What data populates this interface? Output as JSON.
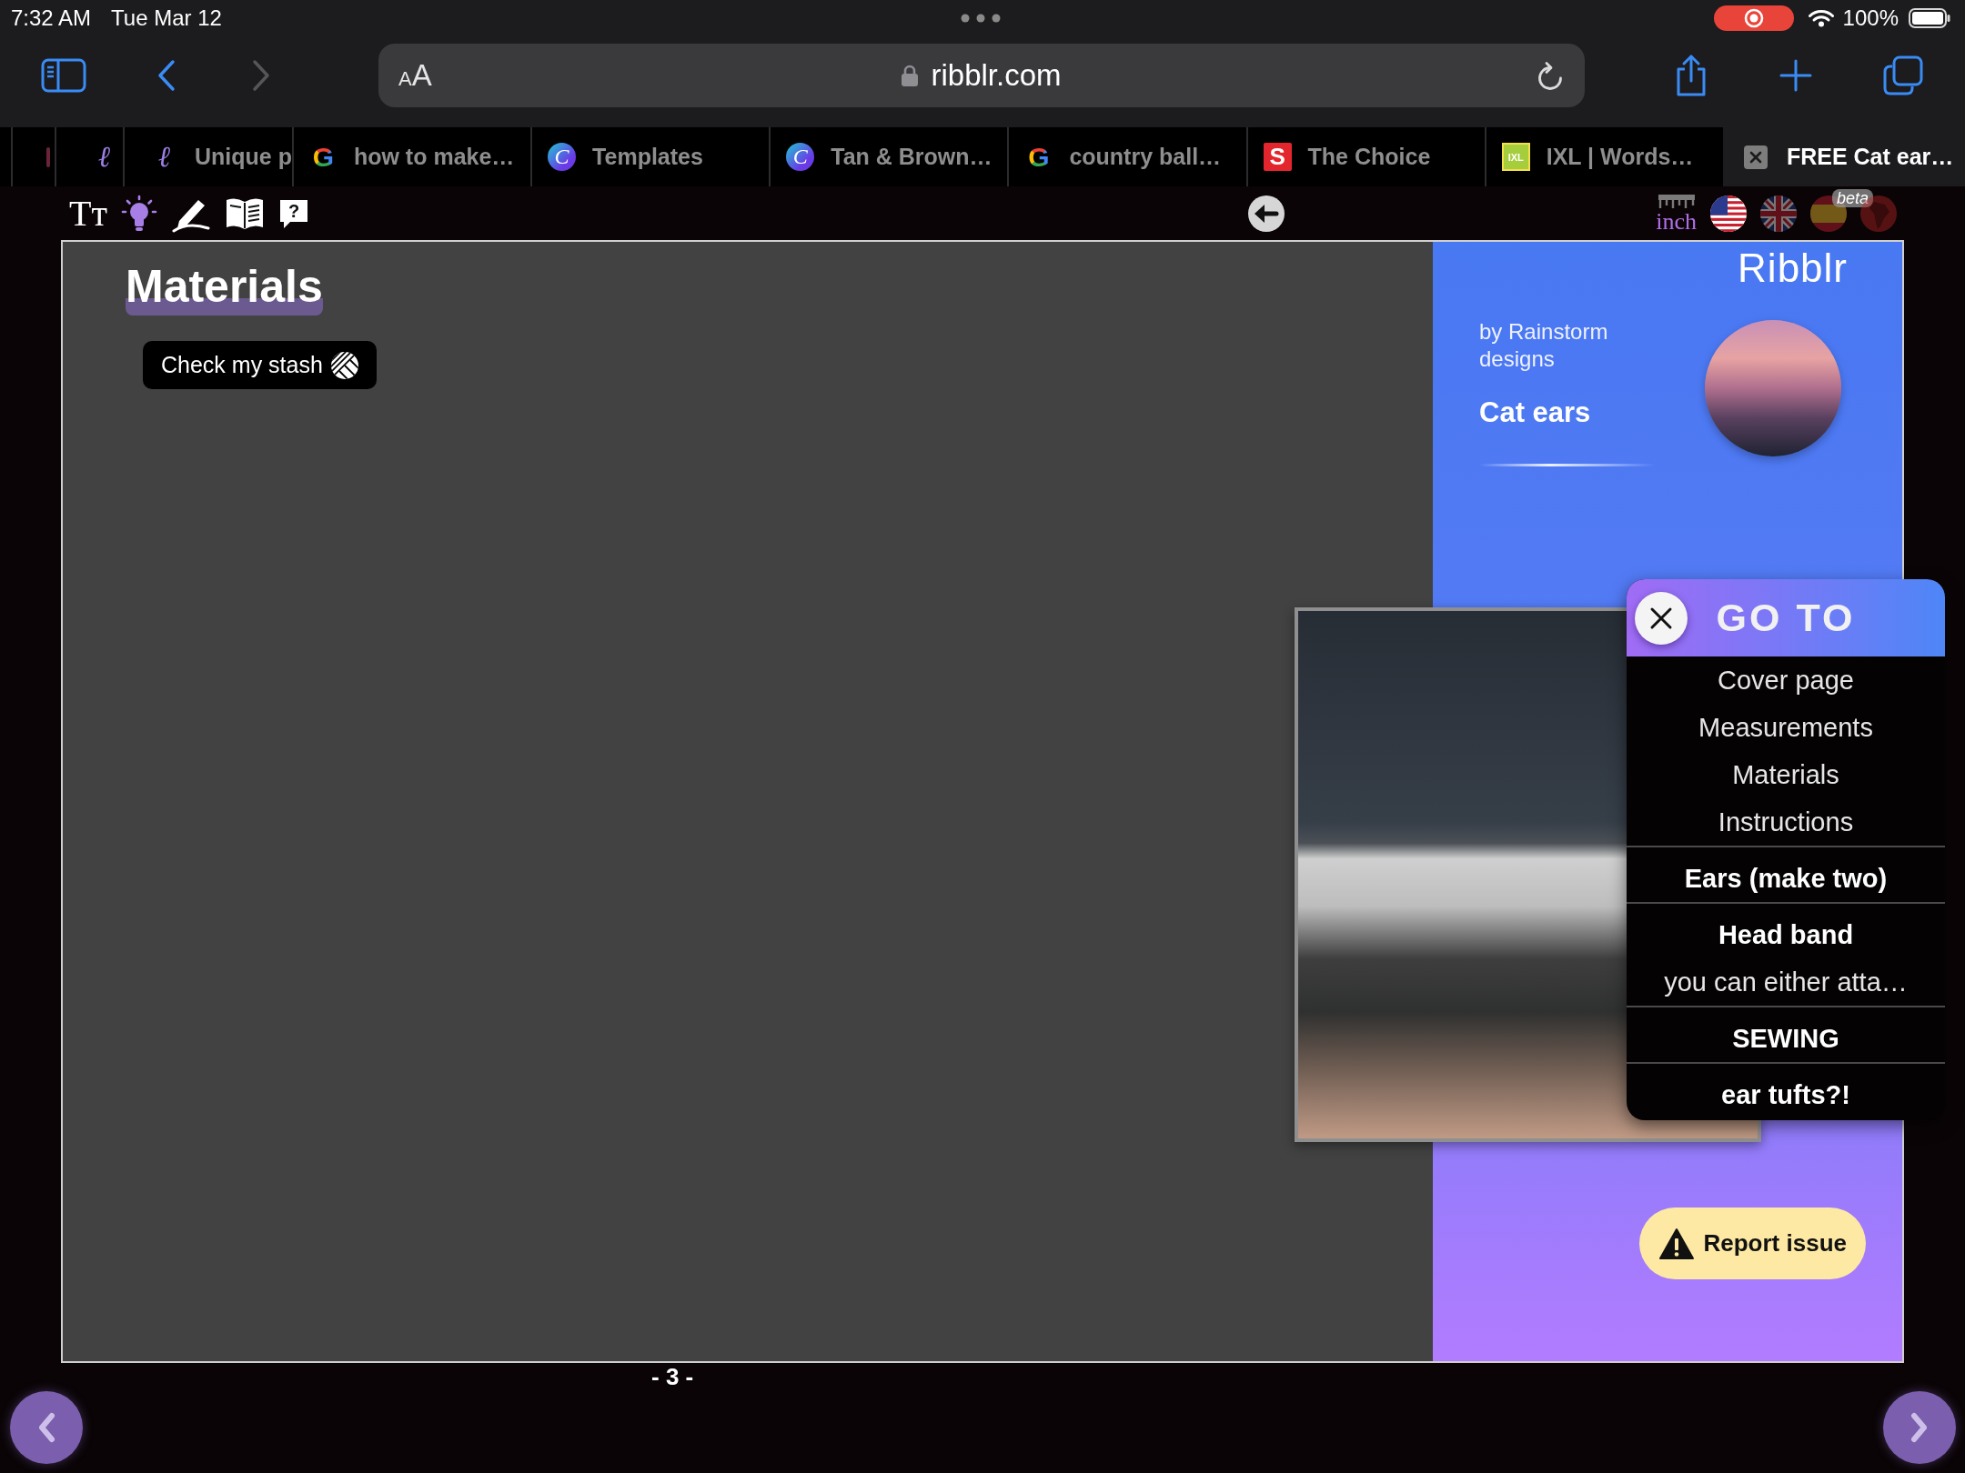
{
  "status_bar": {
    "time": "7:32 AM",
    "date": "Tue Mar 12",
    "screen_recording": true,
    "battery_text": "100%"
  },
  "browser_toolbar": {
    "back_disabled": false,
    "forward_disabled": true,
    "page_menu": "AA",
    "url": "ribblr.com",
    "secure": true
  },
  "tabs": [
    {
      "favicon": {
        "kind": "partial"
      },
      "selected": false
    },
    {
      "favicon": {
        "kind": "script",
        "glyph": "ℓ"
      },
      "selected": false
    },
    {
      "title": "Unique p",
      "cut": true,
      "favicon": {
        "kind": "script",
        "glyph": "ℓ"
      },
      "selected": false
    },
    {
      "title": "how to make…",
      "favicon": {
        "kind": "google",
        "glyph": "G"
      },
      "selected": false
    },
    {
      "title": "Templates",
      "favicon": {
        "kind": "canva",
        "glyph": "C"
      },
      "selected": false
    },
    {
      "title": "Tan & Brown…",
      "favicon": {
        "kind": "canva",
        "glyph": "C"
      },
      "selected": false
    },
    {
      "title": "country ball…",
      "favicon": {
        "kind": "google",
        "glyph": "G"
      },
      "selected": false
    },
    {
      "title": "The Choice",
      "favicon": {
        "kind": "tile",
        "glyph": "S"
      },
      "selected": false
    },
    {
      "title": "IXL | Words…",
      "favicon": {
        "kind": "ixl",
        "glyph": "IXL"
      },
      "selected": false
    },
    {
      "title": "FREE Cat ear…",
      "selected": true
    }
  ],
  "site_toolbar": {
    "text_size": "Tт",
    "help": "?",
    "units": "inch",
    "languages": [
      {
        "kind": "us",
        "selected": true
      },
      {
        "kind": "uk",
        "selected": false
      },
      {
        "kind": "es",
        "selected": false,
        "badge": "beta"
      },
      {
        "kind": "south_america",
        "selected": false
      }
    ]
  },
  "page": {
    "heading": "Materials",
    "stash_button": "Check my stash",
    "page_number": "- 3 -"
  },
  "sidebar": {
    "logo": "Ribblr",
    "byline": "by Rainstorm designs",
    "title": "Cat ears",
    "report_button": "Report issue"
  },
  "goto_menu": {
    "title": "GO TO",
    "sections": [
      {
        "items": [
          {
            "label": "Cover page",
            "kind": "entry"
          },
          {
            "label": "Measurements",
            "kind": "entry"
          },
          {
            "label": "Materials",
            "kind": "entry"
          },
          {
            "label": "Instructions",
            "kind": "entry"
          }
        ]
      },
      {
        "items": [
          {
            "label": "Ears (make two)",
            "kind": "heading"
          }
        ]
      },
      {
        "items": [
          {
            "label": "Head band",
            "kind": "heading"
          },
          {
            "label": "you can either atta…",
            "kind": "entry"
          }
        ]
      },
      {
        "items": [
          {
            "label": "SEWING",
            "kind": "heading"
          }
        ]
      },
      {
        "items": [
          {
            "label": "ear tufts?!",
            "kind": "heading"
          }
        ]
      }
    ]
  }
}
